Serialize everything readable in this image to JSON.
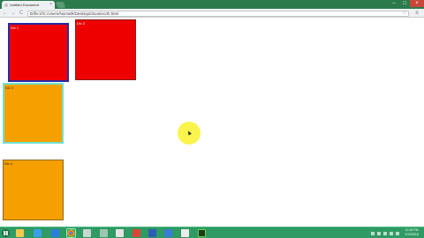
{
  "browser": {
    "tab_title": "Untitled Document",
    "tab_close": "×",
    "window": {
      "minimize": "–",
      "maximize": "□",
      "close": "×"
    },
    "nav": {
      "back": "←",
      "forward": "→",
      "reload": "C"
    },
    "address": "file:///C:/Users/Nomath/Desktop/cbootsrc/Zr.html",
    "star": "☆",
    "menu": "≡"
  },
  "boxes": [
    {
      "label": "Div 1",
      "bg": "#ee0000",
      "border": "#2a2aa0"
    },
    {
      "label": "Div 2",
      "bg": "#ee0000",
      "border": "#8a1a1a"
    },
    {
      "label": "Div 3",
      "bg": "#f5a000",
      "border": "#6fe0d0"
    },
    {
      "label": "Div 4",
      "bg": "#f5a000",
      "border": "#8a6a20"
    }
  ],
  "taskbar": {
    "icons": [
      "explorer-icon",
      "store-icon",
      "ie-icon",
      "chrome-icon",
      "app-icon",
      "app-icon-2",
      "app-icon-3",
      "app-icon-4",
      "word-icon",
      "app-icon-5",
      "app-icon-6",
      "dreamweaver-icon"
    ],
    "clock_time": "12:18 PM",
    "clock_date": "1/13/2016"
  },
  "colors": {
    "titlebar": "#2b7a4b",
    "taskbar": "#2f9a63",
    "cursor_highlight": "#fbf33a"
  }
}
